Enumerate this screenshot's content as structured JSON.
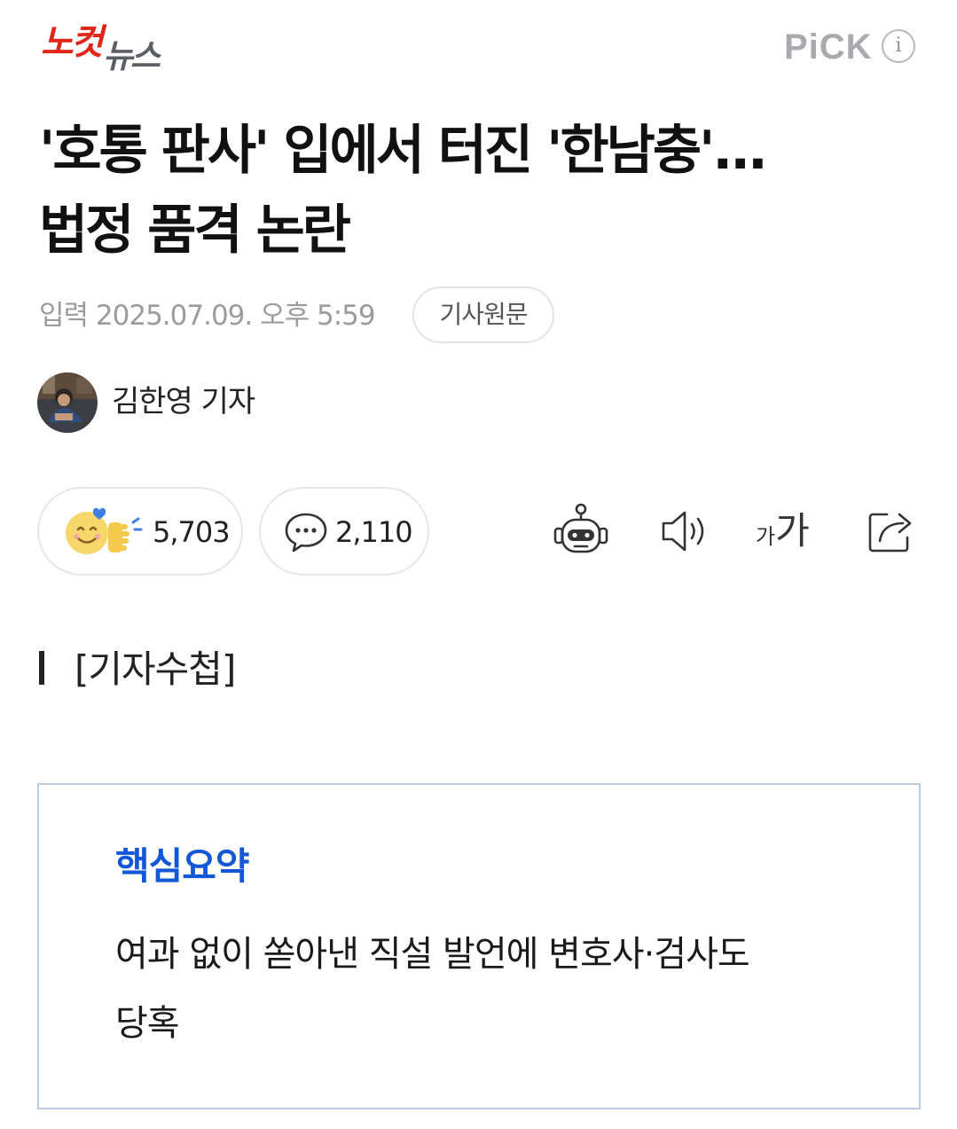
{
  "header": {
    "logo_part1": "노컷",
    "logo_part2": "뉴스",
    "pick_label": "PiCK",
    "pick_info_icon": "i"
  },
  "article": {
    "headline": "'호통 판사' 입에서 터진 '한남충'...\n법정 품격 논란",
    "input_label": "입력 2025.07.09. 오후 5:59",
    "original_button": "기사원문",
    "reporter": "김한영 기자"
  },
  "reactions": {
    "like_count": "5,703",
    "comment_count": "2,110"
  },
  "toolbar": {
    "icons": [
      "summary-bot-icon",
      "audio-speaker-icon",
      "font-size-icon",
      "share-icon"
    ],
    "font_small": "가",
    "font_large": "가"
  },
  "section": {
    "title": "[기자수첩]"
  },
  "summary": {
    "title": "핵심요약",
    "text": "여과 없이 쏟아낸 직설 발언에 변호사·검사도\n당혹"
  },
  "colors": {
    "brand_red": "#e0261b",
    "summary_blue": "#1258d6",
    "summary_border": "#b9cde5"
  }
}
